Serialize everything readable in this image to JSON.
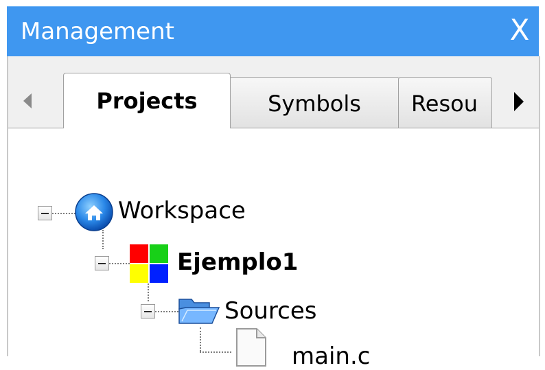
{
  "window": {
    "title": "Management",
    "close_symbol": "X",
    "title_bar_color": "#3f97f0"
  },
  "tabs": [
    {
      "label": "Projects",
      "selected": true
    },
    {
      "label": "Symbols",
      "selected": false
    },
    {
      "label": "Resou",
      "selected": false
    }
  ],
  "tab_scroll": {
    "left_icon": "scroll-left-arrow-icon",
    "right_icon": "scroll-right-arrow-icon"
  },
  "tree": {
    "workspace": {
      "label": "Workspace",
      "icon": "workspace-home-icon",
      "expanded": true
    },
    "project": {
      "label": "Ejemplo1",
      "icon": "project-colored-squares-icon",
      "expanded": true
    },
    "folder": {
      "label": "Sources",
      "icon": "open-folder-icon",
      "expanded": true
    },
    "file": {
      "label": "main.c",
      "icon": "file-icon"
    }
  }
}
